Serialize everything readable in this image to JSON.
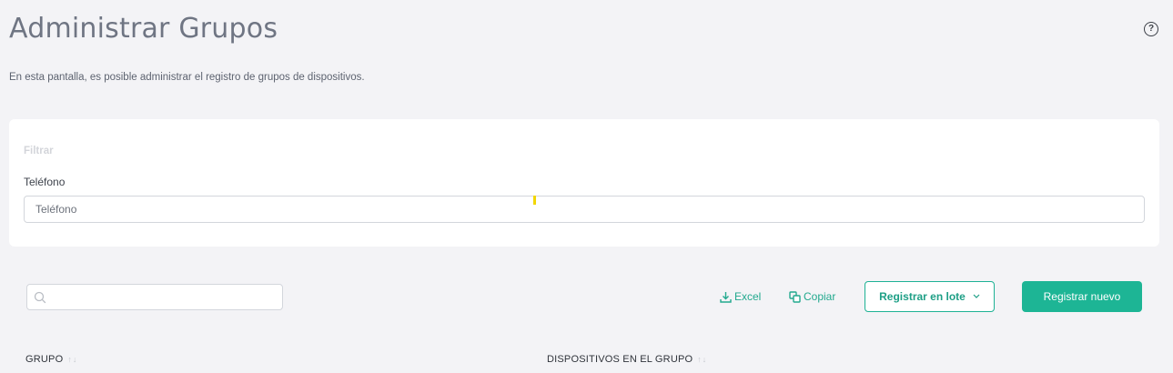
{
  "header": {
    "title": "Administrar Grupos",
    "description": "En esta pantalla, es posible administrar el registro de grupos de dispositivos.",
    "help_glyph": "?"
  },
  "filter": {
    "title": "Filtrar",
    "phone_label": "Teléfono",
    "phone_placeholder": "Teléfono",
    "phone_value": ""
  },
  "toolbar": {
    "search_placeholder": "",
    "excel_label": "Excel",
    "copy_label": "Copiar",
    "batch_label": "Registrar en lote",
    "new_label": "Registrar nuevo"
  },
  "table": {
    "columns": [
      {
        "label": "GRUPO"
      },
      {
        "label": "DISPOSITIVOS EN EL GRUPO"
      }
    ]
  },
  "colors": {
    "accent": "#1db595",
    "background": "#f3f3f6",
    "cursor_marker": "#f2d600"
  },
  "icons": [
    "help-icon",
    "search-icon",
    "download-icon",
    "copy-icon",
    "chevron-down-icon",
    "sort-icon"
  ]
}
